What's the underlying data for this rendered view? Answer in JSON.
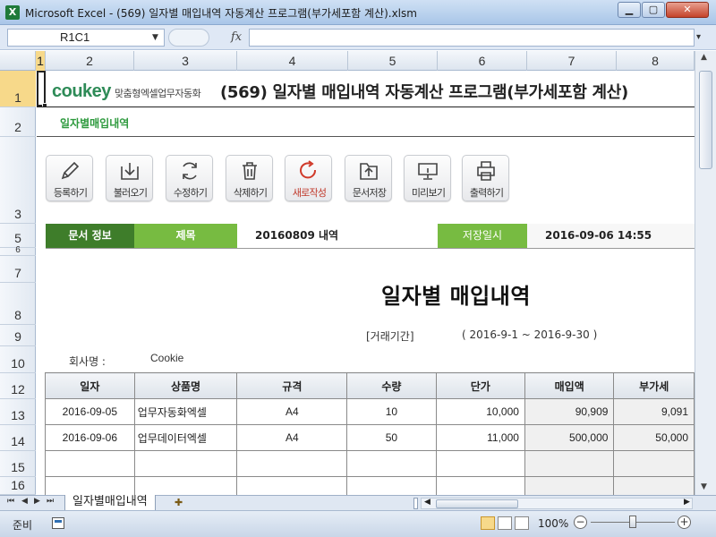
{
  "window": {
    "title": "Microsoft Excel - (569) 일자별 매입내역 자동계산 프로그램(부가세포함 계산).xlsm"
  },
  "formula_bar": {
    "name_box": "R1C1",
    "fx": "fx",
    "formula": ""
  },
  "columns": [
    "1",
    "2",
    "3",
    "4",
    "5",
    "6",
    "7",
    "8"
  ],
  "rows": [
    "1",
    "2",
    "3",
    "5",
    "6",
    "7",
    "8",
    "9",
    "10",
    "12",
    "13",
    "14",
    "15",
    "16"
  ],
  "header": {
    "logo": "coukey",
    "logo_tagline": "맞춤형엑셀업무자동화",
    "title": "(569) 일자별 매입내역 자동계산 프로그램(부가세포함 계산)",
    "subtitle": "일자별매입내역"
  },
  "toolbar": [
    {
      "id": "register",
      "label": "등록하기",
      "icon": "pencil-icon"
    },
    {
      "id": "load",
      "label": "불러오기",
      "icon": "download-tray-icon"
    },
    {
      "id": "edit",
      "label": "수정하기",
      "icon": "refresh-icon"
    },
    {
      "id": "delete",
      "label": "삭제하기",
      "icon": "trash-icon"
    },
    {
      "id": "new",
      "label": "새로작성",
      "icon": "reload-red-icon"
    },
    {
      "id": "save-doc",
      "label": "문서저장",
      "icon": "upload-folder-icon"
    },
    {
      "id": "preview",
      "label": "미리보기",
      "icon": "monitor-icon"
    },
    {
      "id": "print",
      "label": "출력하기",
      "icon": "printer-icon"
    }
  ],
  "doc_info": {
    "section_label": "문서 정보",
    "title_label": "제목",
    "title_value": "20160809 내역",
    "saved_label": "저장일시",
    "saved_value": "2016-09-06 14:55"
  },
  "document": {
    "title": "일자별 매입내역",
    "period_label": "[거래기간]",
    "period_value": "( 2016-9-1 ~ 2016-9-30 )",
    "company_label": "회사명 :",
    "company_value": "Cookie"
  },
  "table": {
    "headers": [
      "일자",
      "상품명",
      "규격",
      "수량",
      "단가",
      "매입액",
      "부가세"
    ],
    "rows": [
      [
        "2016-09-05",
        "업무자동화엑셀",
        "A4",
        "10",
        "10,000",
        "90,909",
        "9,091"
      ],
      [
        "2016-09-06",
        "업무데이터엑셀",
        "A4",
        "50",
        "11,000",
        "500,000",
        "50,000"
      ],
      [
        "",
        "",
        "",
        "",
        "",
        "",
        ""
      ],
      [
        "",
        "",
        "",
        "",
        "",
        "",
        ""
      ]
    ]
  },
  "sheet_tabs": {
    "active": "일자별매입내역"
  },
  "status_bar": {
    "status": "준비",
    "zoom": "100%"
  },
  "colors": {
    "accent_dark_green": "#3e7d2a",
    "accent_light_green": "#77bb41",
    "logo_green": "#2e8b57",
    "selection": "#f7d98a"
  }
}
